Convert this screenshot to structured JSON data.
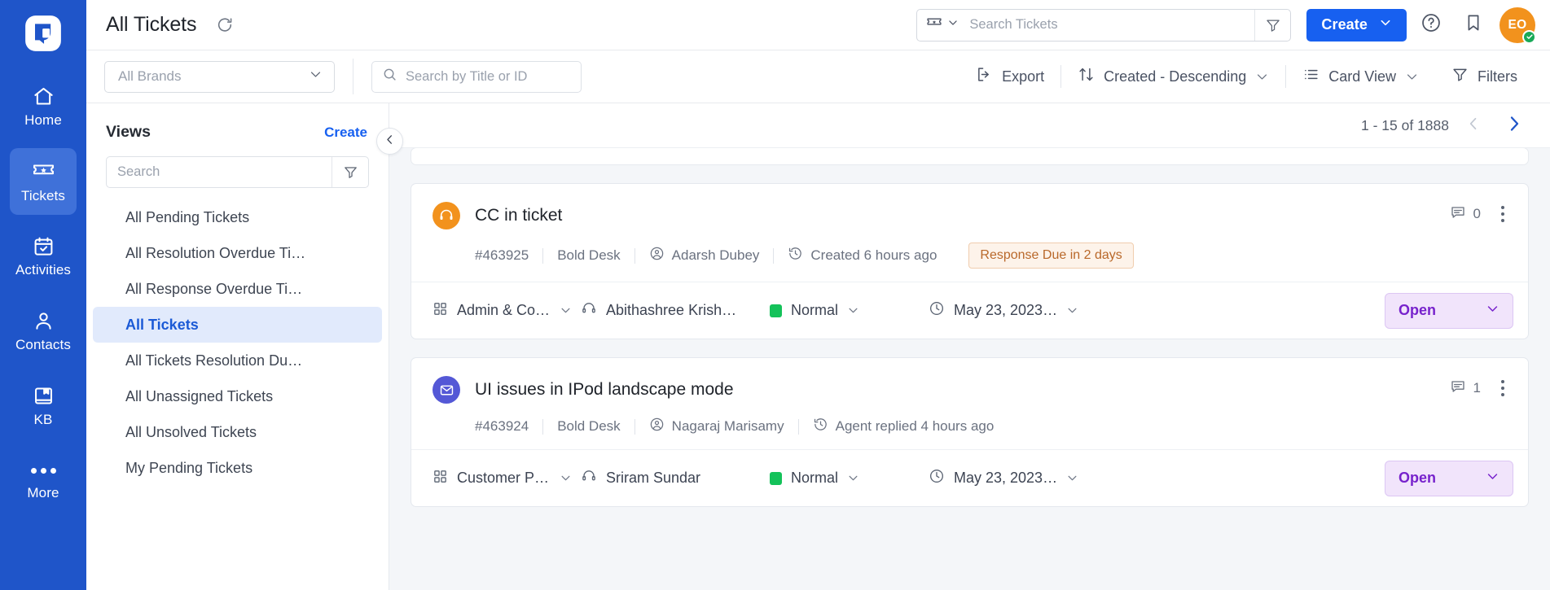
{
  "rail": {
    "logo": "bold-desk-logo",
    "items": [
      {
        "label": "Home",
        "icon": "home-icon",
        "active": false
      },
      {
        "label": "Tickets",
        "icon": "ticket-icon",
        "active": true
      },
      {
        "label": "Activities",
        "icon": "calendar-check-icon",
        "active": false
      },
      {
        "label": "Contacts",
        "icon": "person-icon",
        "active": false
      },
      {
        "label": "KB",
        "icon": "book-icon",
        "active": false
      },
      {
        "label": "More",
        "icon": "ellipsis-icon",
        "active": false
      }
    ]
  },
  "topbar": {
    "title": "All Tickets",
    "refresh_icon": "refresh-icon",
    "search": {
      "type_icon": "ticket-icon",
      "placeholder": "Search Tickets",
      "value": "",
      "filter_icon": "funnel-icon"
    },
    "create_label": "Create",
    "help_icon": "help-circle-icon",
    "bookmark_icon": "bookmark-icon",
    "avatar_initials": "EO",
    "avatar_color": "#f2921d",
    "avatar_status_color": "#18a957"
  },
  "toolbar": {
    "brand_placeholder": "All Brands",
    "title_search_placeholder": "Search by Title or ID",
    "title_search_value": "",
    "export_label": "Export",
    "sort_label": "Created - Descending",
    "view_label": "Card View",
    "filters_label": "Filters"
  },
  "views": {
    "title": "Views",
    "create_label": "Create",
    "search_placeholder": "Search",
    "search_value": "",
    "items": [
      {
        "label": "All Pending Tickets",
        "active": false
      },
      {
        "label": "All Resolution Overdue Ti…",
        "active": false
      },
      {
        "label": "All Response Overdue Ti…",
        "active": false
      },
      {
        "label": "All Tickets",
        "active": true
      },
      {
        "label": "All Tickets Resolution Du…",
        "active": false
      },
      {
        "label": "All Unassigned Tickets",
        "active": false
      },
      {
        "label": "All Unsolved Tickets",
        "active": false
      },
      {
        "label": "My Pending Tickets",
        "active": false
      }
    ]
  },
  "list": {
    "pagination": "1 - 15 of 1888",
    "prev_enabled": false,
    "next_enabled": true,
    "cards": [
      {
        "channel_icon": "headset-icon",
        "channel_color": "#f2921d",
        "title": "CC in ticket",
        "comment_count": "0",
        "id": "#463925",
        "brand": "Bold Desk",
        "requester": "Adarsh Dubey",
        "activity": "Created 6 hours ago",
        "sla_badge": "Response Due in 2 days",
        "category": "Admin & Con…",
        "agent": "Abithashree Krish…",
        "priority": "Normal",
        "priority_color": "#14c25a",
        "due": "May 23, 2023…",
        "status": "Open"
      },
      {
        "channel_icon": "envelope-icon",
        "channel_color": "#5458d6",
        "title": "UI issues in IPod landscape mode",
        "comment_count": "1",
        "id": "#463924",
        "brand": "Bold Desk",
        "requester": "Nagaraj Marisamy",
        "activity": "Agent replied 4 hours ago",
        "sla_badge": "",
        "category": "Customer Po…",
        "agent": "Sriram Sundar",
        "priority": "Normal",
        "priority_color": "#14c25a",
        "due": "May 23, 2023…",
        "status": "Open"
      }
    ]
  }
}
